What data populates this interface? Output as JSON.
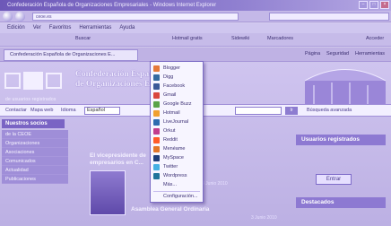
{
  "window": {
    "title": "Confederación Española de Organizaciones Empresariales - Windows Internet Explorer"
  },
  "address": {
    "url": "ceoe.es",
    "search_placeholder": ""
  },
  "menubar": [
    "Edición",
    "Ver",
    "Favoritos",
    "Herramientas",
    "Ayuda"
  ],
  "links_toolbar": {
    "buscar": "Buscar",
    "hotmail": "Hotmail gratis",
    "sidewiki": "Sidewiki",
    "marcadores": "Marcadores",
    "acceder": "Acceder"
  },
  "tab": {
    "label": "Confederación Española de Organizaciones E...",
    "pagina": "Página",
    "seguridad": "Seguridad",
    "herramientas": "Herramientas"
  },
  "site": {
    "title_line1": "Confederación Española",
    "title_line2": "de Organizaciones Emp",
    "subtitle": "de usuarios registrados"
  },
  "linkbar": {
    "contactar": "Contactar",
    "mapa": "Mapa web",
    "idioma": "Idioma",
    "lang_value": "Español",
    "busqueda_avanzada": "Búsqueda avanzada",
    "search_button": "Ir"
  },
  "left": {
    "heading": "Nuestros socios",
    "items": [
      "de la CEOE",
      "Organizaciones",
      "Asociaciones",
      "Comunicados",
      "Actualidad",
      "Publicaciones"
    ]
  },
  "news": {
    "title": "El vicepresidente de empresarios en C...",
    "asamblea": "Asamblea General Ordinaria",
    "fecha1": "3 Junio 2010",
    "fecha2": "3 Junio 2010"
  },
  "right": {
    "usuarios": "Usuarios registrados",
    "entrar": "Entrar",
    "destacados": "Destacados"
  },
  "dropdown": {
    "items": [
      "Blogger",
      "Digg",
      "Facebook",
      "Gmail",
      "Google Buzz",
      "Hotmail",
      "LiveJournal",
      "Orkut",
      "Reddit",
      "Menéame",
      "MySpace",
      "Twitter",
      "Wordpress",
      "Más...",
      "Configuración..."
    ]
  },
  "colors": {
    "accent": "#7a64c4",
    "tint": "#c9bfe9"
  }
}
